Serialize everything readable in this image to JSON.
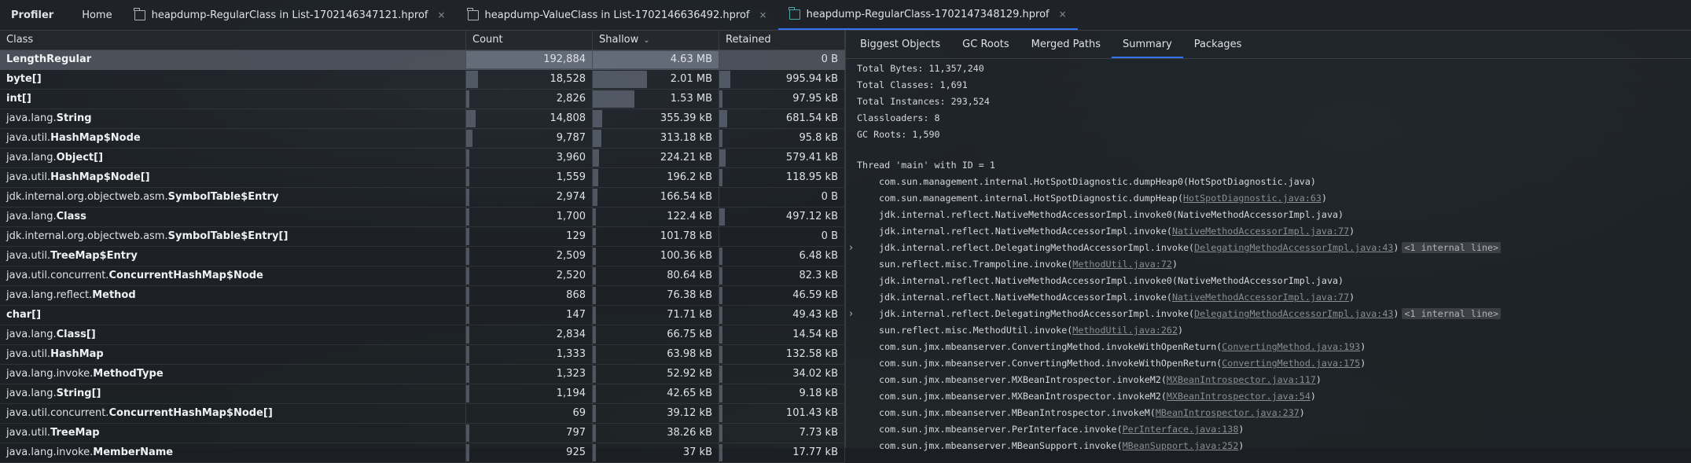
{
  "tabs": [
    {
      "label": "Profiler",
      "kind": "app",
      "closable": false
    },
    {
      "label": "Home",
      "kind": "plain",
      "closable": false
    },
    {
      "label": "heapdump-RegularClass in List-1702146347121.hprof",
      "kind": "file",
      "closable": true
    },
    {
      "label": "heapdump-ValueClass in List-1702146636492.hprof",
      "kind": "file",
      "closable": true
    },
    {
      "label": "heapdump-RegularClass-1702147348129.hprof",
      "kind": "file",
      "closable": true,
      "active": true
    }
  ],
  "close_glyph": "×",
  "table": {
    "columns": {
      "class": "Class",
      "count": "Count",
      "shallow": "Shallow",
      "retained": "Retained"
    },
    "rows": [
      {
        "pkg": "",
        "cls": "LengthRegular",
        "count": "192,884",
        "shallow": "4.63 MB",
        "retained": "0 B",
        "cf": 1.0,
        "sf": 1.0,
        "rf": 0,
        "selected": true
      },
      {
        "pkg": "",
        "cls": "byte[]",
        "count": "18,528",
        "shallow": "2.01 MB",
        "retained": "995.94 kB",
        "cf": 0.096,
        "sf": 0.43,
        "rf": 0.09
      },
      {
        "pkg": "",
        "cls": "int[]",
        "count": "2,826",
        "shallow": "1.53 MB",
        "retained": "97.95 kB",
        "cf": 0.015,
        "sf": 0.33,
        "rf": 0.01
      },
      {
        "pkg": "java.lang.",
        "cls": "String",
        "count": "14,808",
        "shallow": "355.39 kB",
        "retained": "681.54 kB",
        "cf": 0.077,
        "sf": 0.075,
        "rf": 0.06
      },
      {
        "pkg": "java.util.",
        "cls": "HashMap$Node",
        "count": "9,787",
        "shallow": "313.18 kB",
        "retained": "95.8 kB",
        "cf": 0.05,
        "sf": 0.066,
        "rf": 0.01
      },
      {
        "pkg": "java.lang.",
        "cls": "Object[]",
        "count": "3,960",
        "shallow": "224.21 kB",
        "retained": "579.41 kB",
        "cf": 0.02,
        "sf": 0.048,
        "rf": 0.05
      },
      {
        "pkg": "java.util.",
        "cls": "HashMap$Node[]",
        "count": "1,559",
        "shallow": "196.2 kB",
        "retained": "118.95 kB",
        "cf": 0.008,
        "sf": 0.041,
        "rf": 0.01
      },
      {
        "pkg": "jdk.internal.org.objectweb.asm.",
        "cls": "SymbolTable$Entry",
        "count": "2,974",
        "shallow": "166.54 kB",
        "retained": "0 B",
        "cf": 0.015,
        "sf": 0.035,
        "rf": 0
      },
      {
        "pkg": "java.lang.",
        "cls": "Class",
        "count": "1,700",
        "shallow": "122.4 kB",
        "retained": "497.12 kB",
        "cf": 0.009,
        "sf": 0.026,
        "rf": 0.045
      },
      {
        "pkg": "jdk.internal.org.objectweb.asm.",
        "cls": "SymbolTable$Entry[]",
        "count": "129",
        "shallow": "101.78 kB",
        "retained": "0 B",
        "cf": 0.001,
        "sf": 0.021,
        "rf": 0
      },
      {
        "pkg": "java.util.",
        "cls": "TreeMap$Entry",
        "count": "2,509",
        "shallow": "100.36 kB",
        "retained": "6.48 kB",
        "cf": 0.013,
        "sf": 0.021,
        "rf": 0.001
      },
      {
        "pkg": "java.util.concurrent.",
        "cls": "ConcurrentHashMap$Node",
        "count": "2,520",
        "shallow": "80.64 kB",
        "retained": "82.3 kB",
        "cf": 0.013,
        "sf": 0.017,
        "rf": 0.007
      },
      {
        "pkg": "java.lang.reflect.",
        "cls": "Method",
        "count": "868",
        "shallow": "76.38 kB",
        "retained": "46.59 kB",
        "cf": 0.004,
        "sf": 0.016,
        "rf": 0.004
      },
      {
        "pkg": "",
        "cls": "char[]",
        "count": "147",
        "shallow": "71.71 kB",
        "retained": "49.43 kB",
        "cf": 0.001,
        "sf": 0.015,
        "rf": 0.004
      },
      {
        "pkg": "java.lang.",
        "cls": "Class[]",
        "count": "2,834",
        "shallow": "66.75 kB",
        "retained": "14.54 kB",
        "cf": 0.015,
        "sf": 0.014,
        "rf": 0.001
      },
      {
        "pkg": "java.util.",
        "cls": "HashMap",
        "count": "1,333",
        "shallow": "63.98 kB",
        "retained": "132.58 kB",
        "cf": 0.007,
        "sf": 0.013,
        "rf": 0.012
      },
      {
        "pkg": "java.lang.invoke.",
        "cls": "MethodType",
        "count": "1,323",
        "shallow": "52.92 kB",
        "retained": "34.02 kB",
        "cf": 0.007,
        "sf": 0.011,
        "rf": 0.003
      },
      {
        "pkg": "java.lang.",
        "cls": "String[]",
        "count": "1,194",
        "shallow": "42.65 kB",
        "retained": "9.18 kB",
        "cf": 0.006,
        "sf": 0.009,
        "rf": 0.001
      },
      {
        "pkg": "java.util.concurrent.",
        "cls": "ConcurrentHashMap$Node[]",
        "count": "69",
        "shallow": "39.12 kB",
        "retained": "101.43 kB",
        "cf": 0.0,
        "sf": 0.008,
        "rf": 0.009
      },
      {
        "pkg": "java.util.",
        "cls": "TreeMap",
        "count": "797",
        "shallow": "38.26 kB",
        "retained": "7.73 kB",
        "cf": 0.004,
        "sf": 0.008,
        "rf": 0.001
      },
      {
        "pkg": "java.lang.invoke.",
        "cls": "MemberName",
        "count": "925",
        "shallow": "37 kB",
        "retained": "17.77 kB",
        "cf": 0.005,
        "sf": 0.008,
        "rf": 0.002
      }
    ]
  },
  "right_tabs": [
    {
      "label": "Biggest Objects"
    },
    {
      "label": "GC Roots"
    },
    {
      "label": "Merged Paths"
    },
    {
      "label": "Summary",
      "active": true
    },
    {
      "label": "Packages"
    }
  ],
  "summary": {
    "total_bytes": "Total Bytes: 11,357,240",
    "total_classes": "Total Classes: 1,691",
    "total_instances": "Total Instances: 293,524",
    "classloaders": "Classloaders: 8",
    "gc_roots": "GC Roots: 1,590"
  },
  "thread_header": "Thread 'main' with ID = 1",
  "stack": [
    {
      "pre": "com.sun.management.internal.HotSpotDiagnostic.dumpHeap0(",
      "link": "",
      "post": "HotSpotDiagnostic.java)"
    },
    {
      "pre": "com.sun.management.internal.HotSpotDiagnostic.dumpHeap(",
      "link": "HotSpotDiagnostic.java:63",
      "post": ")"
    },
    {
      "pre": "jdk.internal.reflect.NativeMethodAccessorImpl.invoke0(",
      "link": "",
      "post": "NativeMethodAccessorImpl.java)"
    },
    {
      "pre": "jdk.internal.reflect.NativeMethodAccessorImpl.invoke(",
      "link": "NativeMethodAccessorImpl.java:77",
      "post": ")"
    },
    {
      "pre": "jdk.internal.reflect.DelegatingMethodAccessorImpl.invoke(",
      "link": "DelegatingMethodAccessorImpl.java:43",
      "post": ")",
      "hint": "<1 internal line>",
      "expander": "›"
    },
    {
      "pre": "sun.reflect.misc.Trampoline.invoke(",
      "link": "MethodUtil.java:72",
      "post": ")"
    },
    {
      "pre": "jdk.internal.reflect.NativeMethodAccessorImpl.invoke0(",
      "link": "",
      "post": "NativeMethodAccessorImpl.java)"
    },
    {
      "pre": "jdk.internal.reflect.NativeMethodAccessorImpl.invoke(",
      "link": "NativeMethodAccessorImpl.java:77",
      "post": ")"
    },
    {
      "pre": "jdk.internal.reflect.DelegatingMethodAccessorImpl.invoke(",
      "link": "DelegatingMethodAccessorImpl.java:43",
      "post": ")",
      "hint": "<1 internal line>",
      "expander": "›"
    },
    {
      "pre": "sun.reflect.misc.MethodUtil.invoke(",
      "link": "MethodUtil.java:262",
      "post": ")"
    },
    {
      "pre": "com.sun.jmx.mbeanserver.ConvertingMethod.invokeWithOpenReturn(",
      "link": "ConvertingMethod.java:193",
      "post": ")"
    },
    {
      "pre": "com.sun.jmx.mbeanserver.ConvertingMethod.invokeWithOpenReturn(",
      "link": "ConvertingMethod.java:175",
      "post": ")"
    },
    {
      "pre": "com.sun.jmx.mbeanserver.MXBeanIntrospector.invokeM2(",
      "link": "MXBeanIntrospector.java:117",
      "post": ")"
    },
    {
      "pre": "com.sun.jmx.mbeanserver.MXBeanIntrospector.invokeM2(",
      "link": "MXBeanIntrospector.java:54",
      "post": ")"
    },
    {
      "pre": "com.sun.jmx.mbeanserver.MBeanIntrospector.invokeM(",
      "link": "MBeanIntrospector.java:237",
      "post": ")"
    },
    {
      "pre": "com.sun.jmx.mbeanserver.PerInterface.invoke(",
      "link": "PerInterface.java:138",
      "post": ")"
    },
    {
      "pre": "com.sun.jmx.mbeanserver.MBeanSupport.invoke(",
      "link": "MBeanSupport.java:252",
      "post": ")"
    }
  ]
}
